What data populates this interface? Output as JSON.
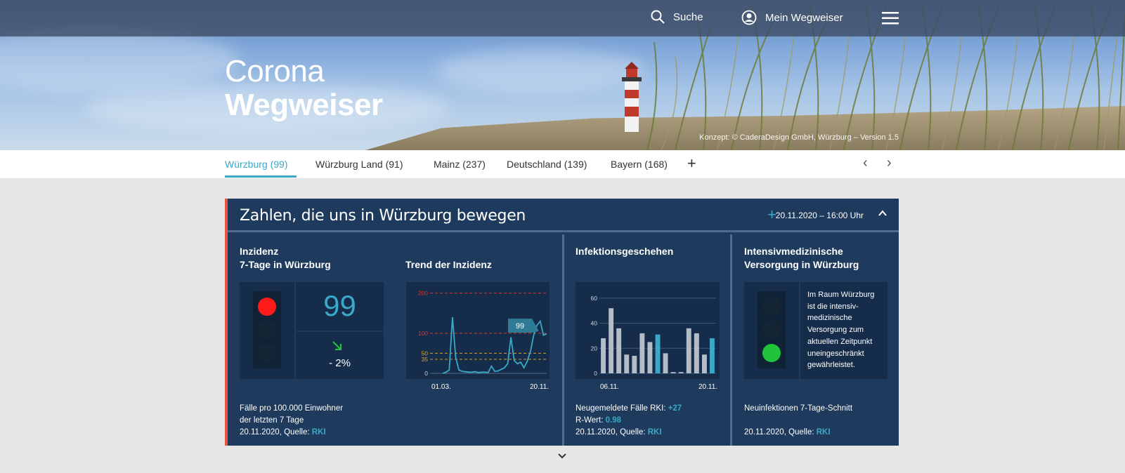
{
  "header": {
    "search_label": "Suche",
    "account_label": "Mein Wegweiser",
    "icons": [
      "search-icon",
      "user-icon",
      "menu-icon"
    ]
  },
  "hero": {
    "title_line1": "Corona",
    "title_line2": "Wegweiser",
    "credit": "Konzept: © CaderaDesign GmbH, Würzburg – Version 1.5"
  },
  "tabs": [
    {
      "label": "Würzburg (99)",
      "active": true
    },
    {
      "label": "Würzburg Land (91)",
      "active": false
    },
    {
      "label": "Mainz (237)",
      "active": false
    },
    {
      "label": "Deutschland (139)",
      "active": false
    },
    {
      "label": "Bayern (168)",
      "active": false
    }
  ],
  "panel": {
    "title": "Zahlen, die uns in Würzburg bewegen",
    "date": "20.11.2020 – 16:00 Uhr",
    "incidence": {
      "heading_line1": "Inzidenz",
      "heading_line2": "7-Tage in Würzburg",
      "value": "99",
      "change": "- 2%",
      "footer_line1": "Fälle pro 100.000 Einwohner",
      "footer_line2": "der letzten 7 Tage",
      "footer_date": "20.11.2020, Quelle:",
      "source": "RKI",
      "signal": "red"
    },
    "trend": {
      "heading": "Trend der Inzidenz",
      "y_ticks": [
        "200",
        "100",
        "50",
        "35",
        "0"
      ],
      "x_start": "01.03.",
      "x_end": "20.11.",
      "callout": "99"
    },
    "infection": {
      "heading": "Infektionsgeschehen",
      "y_ticks": [
        "60",
        "40",
        "20",
        "0"
      ],
      "x_start": "06.11.",
      "x_end": "20.11.",
      "new_cases_label": "Neugemeldete Fälle RKI:",
      "new_cases_value": "+27",
      "r_label": "R-Wert:",
      "r_value": "0.98",
      "footer_date": "20.11.2020, Quelle:",
      "source": "RKI"
    },
    "icu": {
      "heading_line1": "Intensivmedizinische",
      "heading_line2": "Versorgung in Würzburg",
      "text": "Im Raum Würzburg ist die intensiv-medizinische Versorgung zum aktuellen Zeitpunkt uneingeschränkt gewährleistet.",
      "footer_label": "Neuinfektionen 7-Tage-Schnitt",
      "footer_date": "20.11.2020, Quelle:",
      "source": "RKI",
      "signal": "green"
    }
  },
  "colors": {
    "accent": "#3aa8c6",
    "panel_bg": "#1e3a5c",
    "panel_border_left": "#e8533a",
    "signal_red": "#ff1a1a",
    "signal_green": "#1fc43a"
  },
  "chart_data": [
    {
      "type": "line",
      "title": "Trend der Inzidenz",
      "x": [
        "01.03.",
        "20.11."
      ],
      "y_ticks": [
        0,
        35,
        50,
        100,
        200
      ],
      "ylim": [
        0,
        210
      ],
      "reference_lines": [
        200,
        100,
        50,
        35
      ],
      "series": [
        {
          "values": [
            0,
            3,
            8,
            140,
            40,
            8,
            5,
            4,
            3,
            3,
            4,
            2,
            3,
            3,
            2,
            18,
            5,
            6,
            10,
            14,
            24,
            90,
            32,
            24,
            28,
            14,
            30,
            55,
            95,
            120,
            130,
            95,
            99
          ]
        }
      ],
      "callout": 99
    },
    {
      "type": "bar",
      "title": "Infektionsgeschehen",
      "x": [
        "06.11.",
        "20.11."
      ],
      "ylim": [
        0,
        65
      ],
      "y_ticks": [
        0,
        20,
        40,
        60
      ],
      "values": [
        28,
        52,
        36,
        15,
        14,
        32,
        25,
        31,
        16,
        1,
        1,
        36,
        32,
        15,
        28
      ],
      "highlight_indices": [
        7,
        14
      ]
    }
  ]
}
